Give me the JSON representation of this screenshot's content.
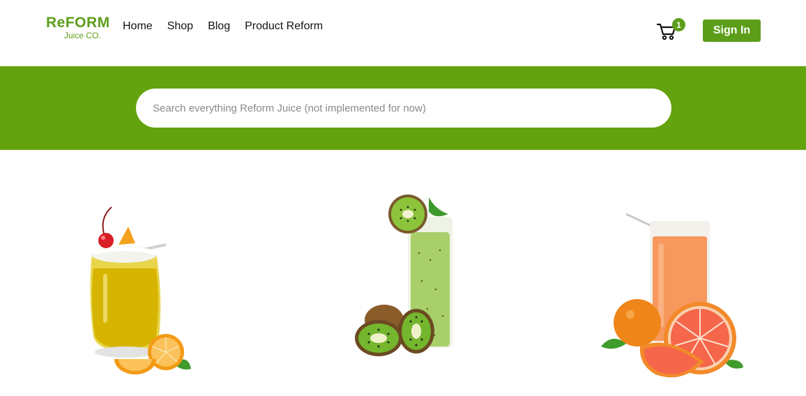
{
  "brand": {
    "name": "ReFORM",
    "tagline": "Juice CO.",
    "accent_color": "#5c9e1a",
    "band_color": "#63a30e"
  },
  "nav": {
    "items": [
      {
        "label": "Home"
      },
      {
        "label": "Shop"
      },
      {
        "label": "Blog"
      },
      {
        "label": "Product Reform"
      }
    ]
  },
  "cart": {
    "icon": "cart-icon",
    "count": "1"
  },
  "auth": {
    "signin_label": "Sign In"
  },
  "search": {
    "placeholder": "Search everything Reform Juice (not implemented for now)",
    "value": ""
  },
  "products": [
    {
      "image": "orange-juice-glass"
    },
    {
      "image": "kiwi-smoothie-glass"
    },
    {
      "image": "grapefruit-juice-glass"
    }
  ]
}
